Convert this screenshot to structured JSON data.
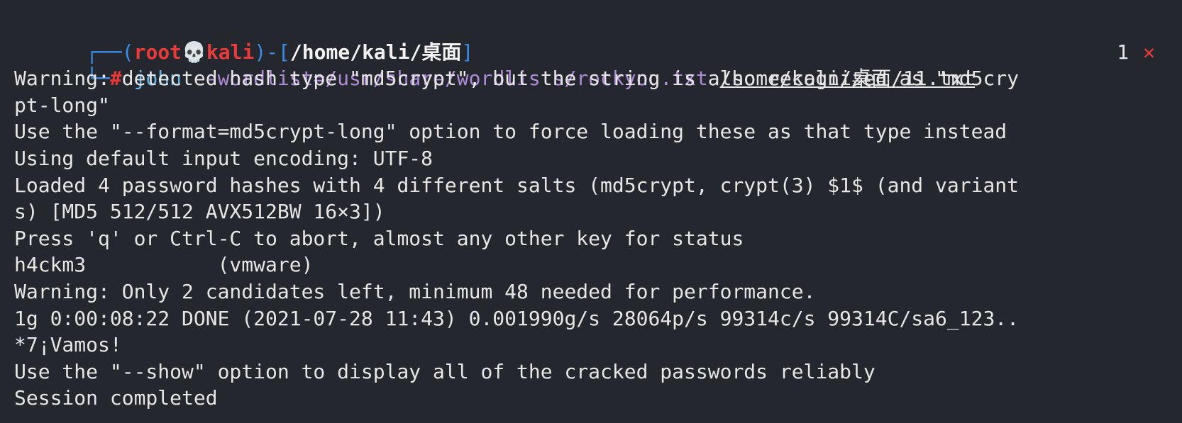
{
  "prompt": {
    "corner_top": "┌──(",
    "user": "root",
    "skull": "💀",
    "host": "kali",
    "between": ")-[",
    "cwd": "/home/kali/桌面",
    "end": "]",
    "corner_bottom": "└─",
    "hash": "#"
  },
  "command": {
    "program": "john",
    "option": "--wordlist=/usr/share/wordlists/rockyou.txt",
    "target": "/home/kali/桌面/11.txt",
    "exit_count": "1",
    "exit_icon": "✕"
  },
  "output": [
    "Warning: detected hash type \"md5crypt\", but the string is also recognized as \"md5cry",
    "pt-long\"",
    "Use the \"--format=md5crypt-long\" option to force loading these as that type instead",
    "Using default input encoding: UTF-8",
    "Loaded 4 password hashes with 4 different salts (md5crypt, crypt(3) $1$ (and variant",
    "s) [MD5 512/512 AVX512BW 16×3])",
    "Press 'q' or Ctrl-C to abort, almost any other key for status",
    "h4ckm3           (vmware)",
    "Warning: Only 2 candidates left, minimum 48 needed for performance.",
    "1g 0:00:08:22 DONE (2021-07-28 11:43) 0.001990g/s 28064p/s 99314c/s 99314C/sa6_123..",
    "*7¡Vamos!",
    "Use the \"--show\" option to display all of the cracked passwords reliably",
    "Session completed"
  ]
}
